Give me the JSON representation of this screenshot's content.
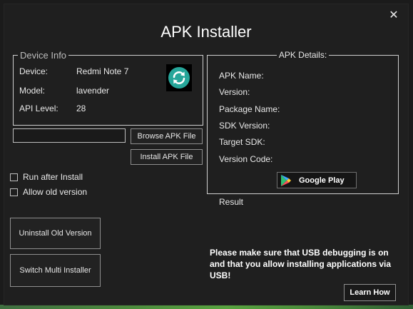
{
  "window": {
    "title": "APK Installer",
    "close_glyph": "✕"
  },
  "device_info": {
    "legend": "Device Info",
    "device_label": "Device:",
    "device_value": "Redmi Note 7",
    "model_label": "Model:",
    "model_value": "lavender",
    "api_label": "API Level:",
    "api_value": "28",
    "refresh_icon": "refresh-icon"
  },
  "file": {
    "path_value": "",
    "browse_label": "Browse APK File",
    "install_label": "Install APK File"
  },
  "options": {
    "run_after_install": "Run after Install",
    "allow_old_version": "Allow old version"
  },
  "buttons": {
    "uninstall_label": "Uninstall Old Version",
    "multi_label": "Switch Multi Installer",
    "learn_label": "Learn How"
  },
  "apk_details": {
    "legend": "APK Details:",
    "fields": [
      "APK Name:",
      "Version:",
      "Package Name:",
      "SDK Version:",
      "Target SDK:",
      "Version Code:"
    ],
    "google_play_label": "Google Play"
  },
  "result_label": "Result",
  "notice": "Please make sure that USB debugging is on and that you allow installing applications via USB!",
  "colors": {
    "accent_teal": "#26a69a",
    "background": "#1f1f1f",
    "border": "#cfcfcf"
  }
}
